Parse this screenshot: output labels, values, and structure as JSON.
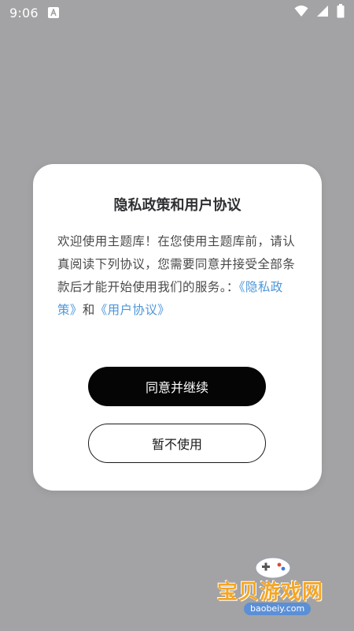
{
  "status_bar": {
    "time": "9:06",
    "app_icon": "a-icon",
    "icons": [
      "wifi-icon",
      "signal-icon",
      "battery-icon"
    ]
  },
  "dialog": {
    "title": "隐私政策和用户协议",
    "body_text": "欢迎使用主题库！在您使用主题库前，请认真阅读下列协议，您需要同意并接受全部条款后才能开始使用我们的服务。：",
    "privacy_link": "《隐私政策》",
    "conjunction": "和",
    "user_agreement_link": "《用户协议》",
    "agree_button": "同意并继续",
    "disagree_button": "暂不使用"
  },
  "watermark": {
    "text": "宝贝游戏网",
    "domain": "baobeiy.com"
  },
  "colors": {
    "overlay": "#a3a3a5",
    "link": "#4d97d9",
    "primary_button": "#050505"
  }
}
